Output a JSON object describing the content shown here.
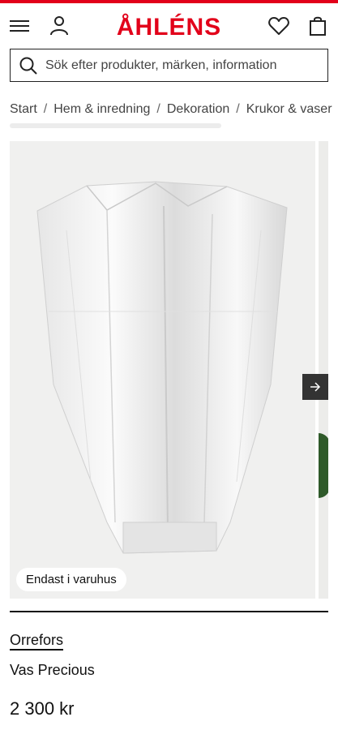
{
  "header": {
    "logo_text": "ÅHLÉNS",
    "brand_color": "#e2001a",
    "icons": [
      "menu-icon",
      "account-icon",
      "heart-icon",
      "bag-icon"
    ]
  },
  "search": {
    "placeholder": "Sök efter produkter, märken, information",
    "value": ""
  },
  "breadcrumb": {
    "items": [
      "Start",
      "Hem & inredning",
      "Dekoration",
      "Krukor & vaser"
    ],
    "separator": "/"
  },
  "gallery": {
    "badge": "Endast i varuhus",
    "next_icon": "arrow-right-icon"
  },
  "product": {
    "brand": "Orrefors",
    "name": "Vas Precious",
    "price": "2 300 kr"
  }
}
